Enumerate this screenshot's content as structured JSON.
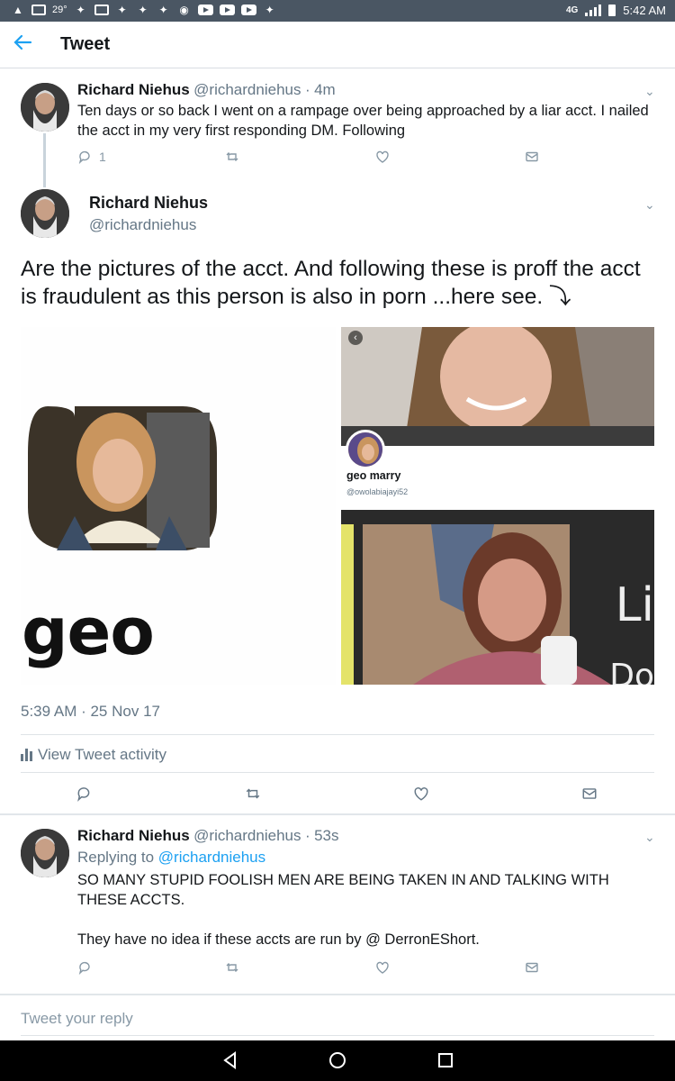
{
  "status_bar": {
    "temperature": "29°",
    "network": "4G",
    "time": "5:42 AM"
  },
  "header": {
    "title": "Tweet"
  },
  "tweet1": {
    "name": "Richard Niehus",
    "handle": "@richardniehus",
    "time": "4m",
    "text": "Ten days or so back I went on a rampage over being approached by a liar acct.  I nailed the acct in my very first responding DM. Following",
    "reply_count": "1"
  },
  "main_tweet": {
    "name": "Richard Niehus",
    "handle": "@richardniehus",
    "text": "Are the pictures of the acct.  And following these is proff the acct is fraudulent as this person is also in porn ...here see. ⤵",
    "timestamp": "5:39 AM · 25 Nov 17",
    "activity_label": "View Tweet activity",
    "media": {
      "left_caption": "geo marry",
      "profile_name": "geo marry",
      "profile_handle": "@owolabiajayi52",
      "br_text_1": "Li",
      "br_text_2": "Do"
    }
  },
  "tweet3": {
    "name": "Richard Niehus",
    "handle": "@richardniehus",
    "time": "53s",
    "replying_prefix": "Replying to",
    "replying_to": "@richardniehus",
    "text_1": "SO MANY STUPID FOOLISH MEN ARE BEING TAKEN IN AND TALKING WITH THESE ACCTS.",
    "text_2": "They have no idea if these accts are run by @ DerronEShort."
  },
  "reply_input": {
    "placeholder": "Tweet your reply"
  },
  "colors": {
    "accent": "#1da1f2",
    "muted": "#657786",
    "status_bar": "#4a5663"
  }
}
